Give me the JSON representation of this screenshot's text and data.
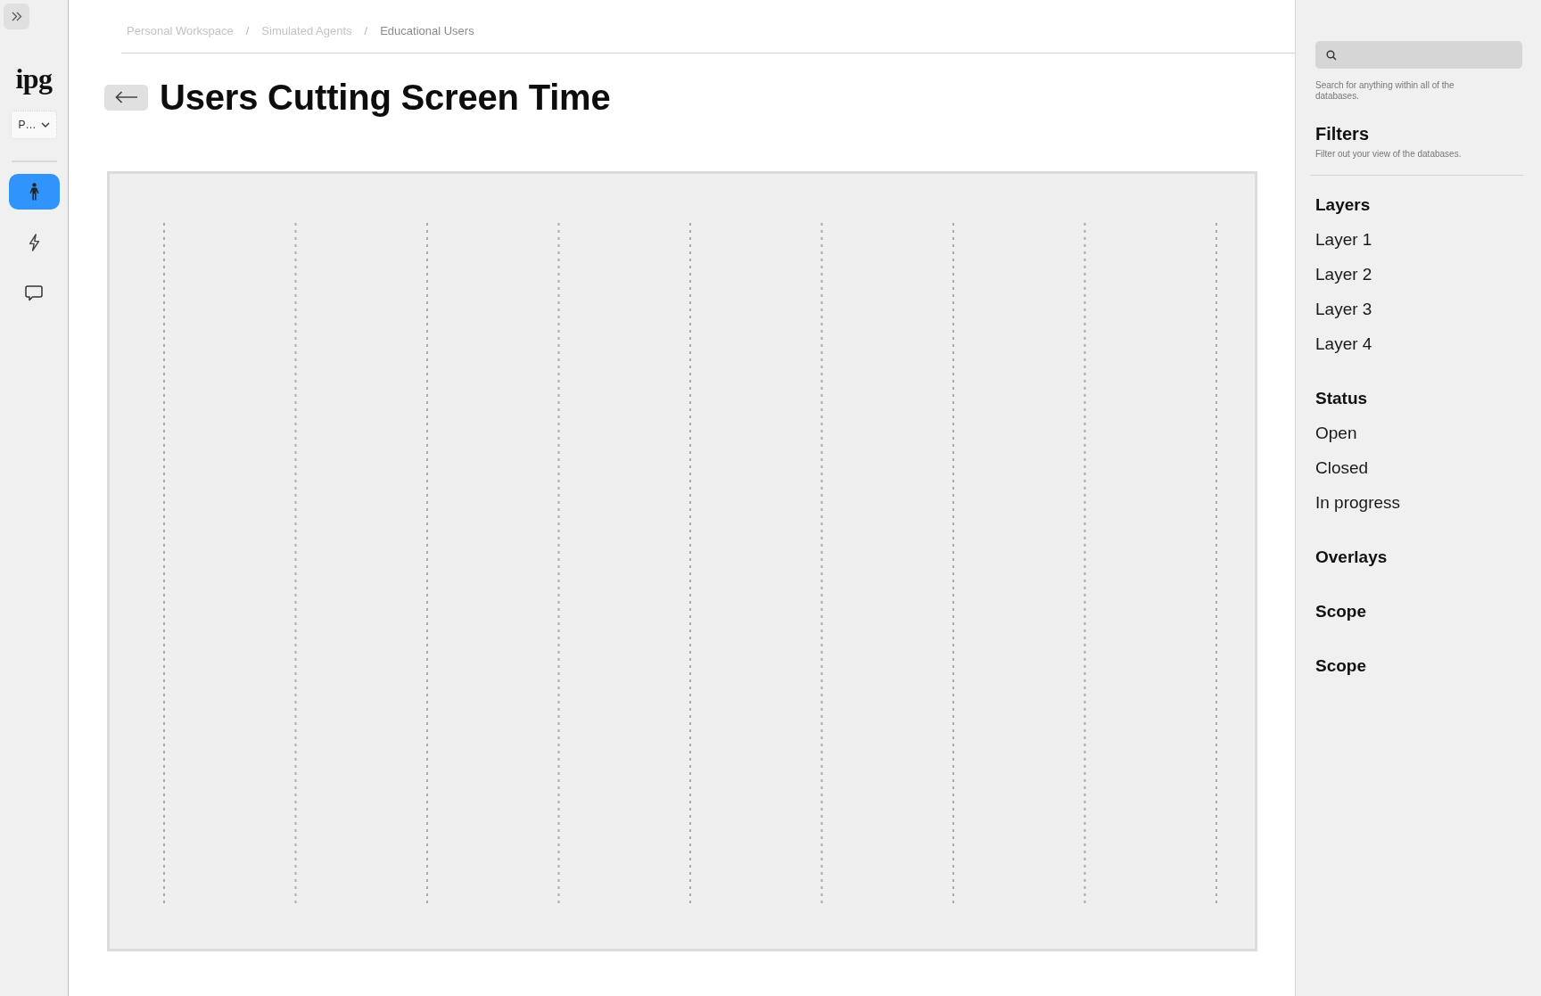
{
  "sidebar": {
    "logo": "ipg",
    "workspace_select": {
      "value": "P…"
    },
    "nav_items": [
      {
        "selected": true
      },
      {
        "selected": false
      },
      {
        "selected": false
      }
    ]
  },
  "breadcrumb": {
    "items": [
      {
        "label": "Personal Workspace",
        "current": false
      },
      {
        "label": "Simulated Agents",
        "current": false
      },
      {
        "label": "Educational Users",
        "current": true
      }
    ],
    "separators": [
      "/",
      "/"
    ]
  },
  "page": {
    "title": "Users Cutting Screen Time"
  },
  "right_panel": {
    "search": {
      "help_text": "Search for anything within all of the databases."
    },
    "filters": {
      "title": "Filters",
      "description": "Filter out your view of the databases.",
      "sections": [
        {
          "title": "Layers",
          "items": [
            "Layer 1",
            "Layer 2",
            "Layer 3",
            "Layer 4"
          ]
        },
        {
          "title": "Status",
          "items": [
            "Open",
            "Closed",
            "In progress"
          ]
        },
        {
          "title": "Overlays"
        },
        {
          "title": "Scope"
        },
        {
          "title": "Scope"
        }
      ]
    }
  }
}
